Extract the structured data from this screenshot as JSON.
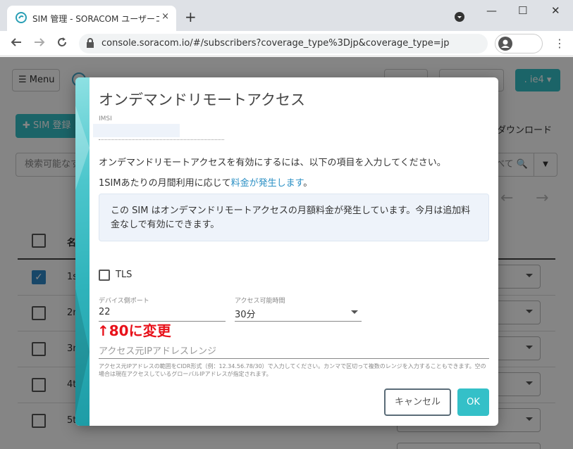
{
  "browser": {
    "tab_title": "SIM 管理 - SORACOM ユーザーコンソ",
    "tab_close": "×",
    "new_tab": "+",
    "url": "console.soracom.io/#/subscribers?coverage_type%3Djp&coverage_type=jp",
    "win_minimize": "—",
    "win_maximize": "☐",
    "win_close": "✕"
  },
  "page": {
    "menu_label": "☰ Menu",
    "operator_label": ". ie4 ▾",
    "sim_register_label": "✚ SIM 登録",
    "download_label": "ダウンロード",
    "search_placeholder": "検索可能なす",
    "search_right_text": "べて 🔍",
    "col_header": "名",
    "rows": [
      "1s",
      "2n",
      "3n",
      "4t",
      "5t"
    ]
  },
  "modal": {
    "title": "オンデマンドリモートアクセス",
    "imsi_label": "IMSI",
    "desc_line1": "オンデマンドリモートアクセスを有効にするには、以下の項目を入力してください。",
    "desc_line2_prefix": "1SIMあたりの月間利用に応じて",
    "desc_line2_link": "料金が発生します",
    "desc_line2_suffix": "。",
    "info_text": "この SIM はオンデマンドリモートアクセスの月額料金が発生しています。今月は追加料金なしで有効にできます。",
    "tls_label": "TLS",
    "port_label": "デバイス側ポート",
    "port_value": "22",
    "duration_label": "アクセス可能時間",
    "duration_value": "30分",
    "annotation": "↑80に変更",
    "ip_placeholder": "アクセス元IPアドレスレンジ",
    "ip_help": "アクセス元IPアドレスの範囲をCIDR形式（例：12.34.56.78/30）で入力してください。カンマで区切って複数のレンジを入力することもできます。空の場合は現在アクセスしているグローバルIPアドレスが指定されます。",
    "cancel_label": "キャンセル",
    "ok_label": "OK"
  },
  "colors": {
    "accent": "#34c0c8",
    "link": "#2a8fc4",
    "annotation": "#e8111a"
  }
}
